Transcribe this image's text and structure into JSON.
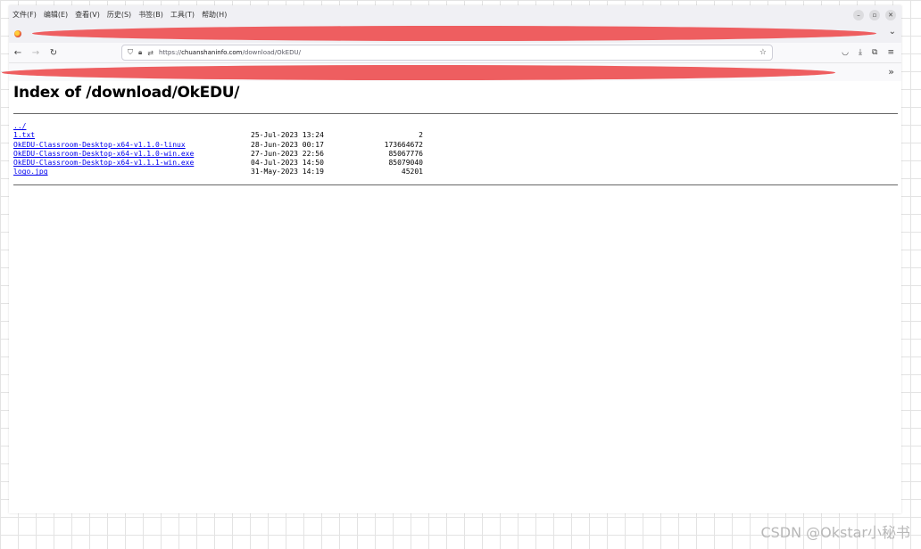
{
  "menubar": {
    "items": [
      "文件(F)",
      "编辑(E)",
      "查看(V)",
      "历史(S)",
      "书签(B)",
      "工具(T)",
      "帮助(H)"
    ]
  },
  "window_controls": {
    "minimize": "–",
    "restore": "▫",
    "close": "✕"
  },
  "navbar": {
    "url_prefix": "https://",
    "url_host": "chuanshaninfo.com",
    "url_path": "/download/OkEDU/"
  },
  "page": {
    "title": "Index of /download/OkEDU/",
    "parent_link": "../",
    "files": [
      {
        "name": "1.txt",
        "date": "25-Jul-2023 13:24",
        "size": "2"
      },
      {
        "name": "OkEDU-Classroom-Desktop-x64-v1.1.0-linux",
        "date": "28-Jun-2023 00:17",
        "size": "173664672"
      },
      {
        "name": "OkEDU-Classroom-Desktop-x64-v1.1.0-win.exe",
        "date": "27-Jun-2023 22:56",
        "size": "85067776"
      },
      {
        "name": "OkEDU-Classroom-Desktop-x64-v1.1.1-win.exe",
        "date": "04-Jul-2023 14:50",
        "size": "85079040"
      },
      {
        "name": "logo.jpg",
        "date": "31-May-2023 14:19",
        "size": "45201"
      }
    ]
  },
  "watermark": "CSDN @Okstar小秘书",
  "colors": {
    "redaction": "#ee5e60",
    "link": "#0000ee",
    "chrome": "#f0f0f4"
  }
}
